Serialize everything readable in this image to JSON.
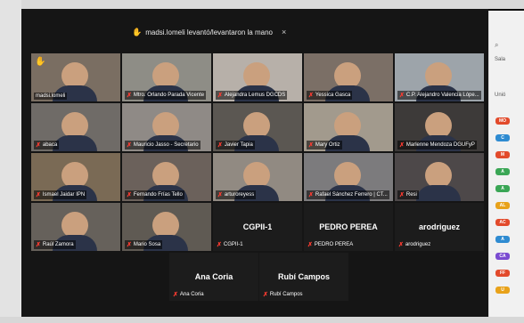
{
  "banner": {
    "text": "madsi.lomeli levantó/levantaron la mano",
    "close": "×"
  },
  "tiles": [
    {
      "name": "madsi.lomeli",
      "bg": "#7a6e62"
    },
    {
      "name": "Mtro. Orlando Parada Vicente",
      "bg": "#8e8d86"
    },
    {
      "name": "Alejandra Lemus DGCDS",
      "bg": "#b7b0a9"
    },
    {
      "name": "Yessica Gasca",
      "bg": "#7b6f66"
    },
    {
      "name": "C.P. Alejandro Valencia Lópe...",
      "bg": "#9da4aa"
    },
    {
      "name": "abaca",
      "bg": "#6f6b67"
    },
    {
      "name": "Mauricio Jasso - Secretario",
      "bg": "#8f8a86"
    },
    {
      "name": "Javier Tapia",
      "bg": "#5b5752"
    },
    {
      "name": "Mary Ortiz",
      "bg": "#a29a8d"
    },
    {
      "name": "Marlenne Mendoza DGUFyP",
      "bg": "#3d3a39"
    },
    {
      "name": "Ismael Jaidar IPN",
      "bg": "#7a6a55"
    },
    {
      "name": "Fernando Frías Tello",
      "bg": "#6b615b"
    },
    {
      "name": "arturoreyess",
      "bg": "#918a82"
    },
    {
      "name": "Rafael Sánchez Ferrero | CT...",
      "bg": "#7c7b7d"
    },
    {
      "name": "Resi",
      "bg": "#4d4849"
    },
    {
      "name": "Raúl Zamora",
      "bg": "#66615b"
    },
    {
      "name": "Mario Sosa",
      "bg": "#5f5a53"
    }
  ],
  "name_tiles": [
    {
      "big": "CGPII-1",
      "small": "CGPII-1"
    },
    {
      "big": "PEDRO PEREA",
      "small": "PEDRO PEREA"
    },
    {
      "big": "arodriguez",
      "small": "arodriguez"
    },
    {
      "big": "Ana Coria",
      "small": "Ana Coria"
    },
    {
      "big": "Rubí Campos",
      "small": "Rubí Campos"
    }
  ],
  "sidebar": {
    "header": "Sala",
    "section": "Unió",
    "badges": [
      {
        "text": "MO",
        "color": "#e24a2b"
      },
      {
        "text": "C",
        "color": "#2e8bd1"
      },
      {
        "text": "M",
        "color": "#e24a2b"
      },
      {
        "text": "A",
        "color": "#3aa655"
      },
      {
        "text": "A",
        "color": "#3aa655"
      },
      {
        "text": "AL",
        "color": "#e8a21a"
      },
      {
        "text": "AC",
        "color": "#e24a2b"
      },
      {
        "text": "A",
        "color": "#2e8bd1"
      },
      {
        "text": "CA",
        "color": "#7a4bd1"
      },
      {
        "text": "FF",
        "color": "#e24a2b"
      },
      {
        "text": "U",
        "color": "#e8a21a"
      }
    ]
  }
}
